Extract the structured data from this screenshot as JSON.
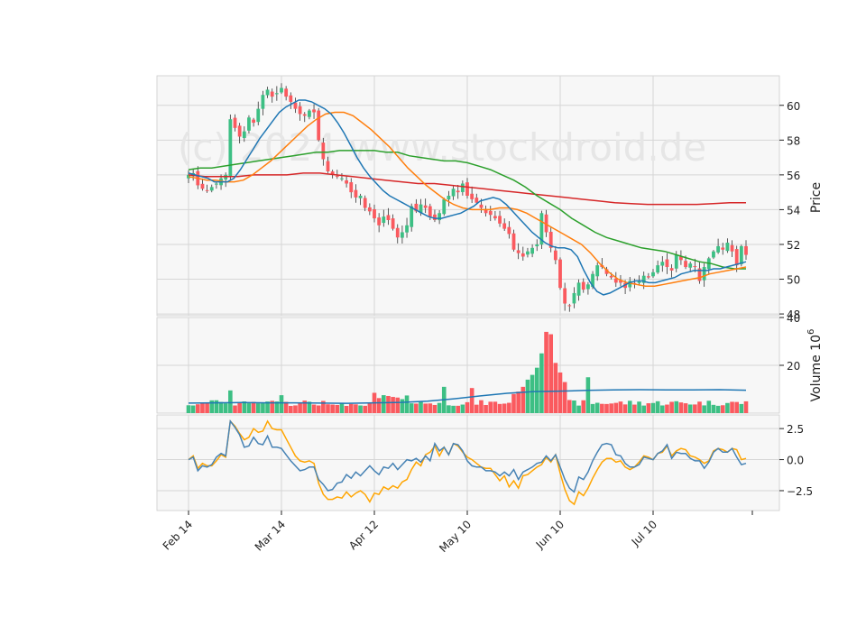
{
  "chart_data": {
    "type": "candlestick",
    "watermark": "(c) 2024 www.stockdroid.de",
    "colors": {
      "up": "#3dbf84",
      "down": "#fa5a5f",
      "sma_fast": "#1f77b4",
      "sma_mid": "#ff7f0e",
      "sma_slow": "#2ca02c",
      "sma_long": "#d62728",
      "vol_avg": "#1f77b4",
      "osc_a": "#4682b4",
      "osc_b": "#ffa500",
      "panel_bg": "#f7f7f7",
      "grid": "#d6d6d6"
    },
    "x_ticks": [
      {
        "label": "Feb 14",
        "index": 0
      },
      {
        "label": "Mar 14",
        "index": 20
      },
      {
        "label": "Apr 12",
        "index": 40
      },
      {
        "label": "May 10",
        "index": 60
      },
      {
        "label": "Jun 10",
        "index": 80
      },
      {
        "label": "Jul 10",
        "index": 100
      }
    ],
    "price_panel": {
      "ylabel": "Price",
      "ylim": [
        47.9,
        61.7
      ],
      "ticks": [
        48,
        50,
        52,
        54,
        56,
        58,
        60
      ],
      "close": [
        56.0,
        56.1,
        55.4,
        55.2,
        55.1,
        55.3,
        55.5,
        55.8,
        56.0,
        59.2,
        58.7,
        58.2,
        58.5,
        59.3,
        59.0,
        59.8,
        60.6,
        60.9,
        60.5,
        60.7,
        61.0,
        60.5,
        60.2,
        59.8,
        59.5,
        59.4,
        59.7,
        59.6,
        58.0,
        56.9,
        56.2,
        56.0,
        55.9,
        55.8,
        55.5,
        55.0,
        54.7,
        54.8,
        54.1,
        53.9,
        53.5,
        53.1,
        53.6,
        53.4,
        52.9,
        52.4,
        52.7,
        53.1,
        54.2,
        53.9,
        54.3,
        54.1,
        53.6,
        53.4,
        53.8,
        54.6,
        54.8,
        55.2,
        55.0,
        55.5,
        54.8,
        54.6,
        54.4,
        54.1,
        53.8,
        53.7,
        53.5,
        53.2,
        52.9,
        52.6,
        51.7,
        51.5,
        51.3,
        51.6,
        51.8,
        52.0,
        53.8,
        52.7,
        51.8,
        51.1,
        49.5,
        48.6,
        48.5,
        49.2,
        49.8,
        49.4,
        49.7,
        50.3,
        50.8,
        50.7,
        50.3,
        50.1,
        49.8,
        49.8,
        49.5,
        49.9,
        49.7,
        49.9,
        50.2,
        50.1,
        50.4,
        50.8,
        51.0,
        50.7,
        50.5,
        51.4,
        51.1,
        50.7,
        50.9,
        50.7,
        49.9,
        50.7,
        51.2,
        51.6,
        51.9,
        51.7,
        52.1,
        51.6,
        50.8,
        51.9,
        51.4
      ],
      "volatility": 0.35,
      "sma_fast": [
        56.1,
        56.0,
        55.9,
        55.8,
        55.6,
        55.6,
        55.6,
        55.8,
        56.3,
        56.9,
        57.5,
        58.1,
        58.6,
        59.1,
        59.6,
        59.9,
        60.1,
        60.3,
        60.3,
        60.2,
        60.0,
        59.8,
        59.5,
        59.0,
        58.4,
        57.7,
        57.0,
        56.4,
        55.9,
        55.5,
        55.1,
        54.8,
        54.6,
        54.4,
        54.2,
        54.0,
        53.8,
        53.6,
        53.5,
        53.5,
        53.6,
        53.7,
        53.8,
        54.0,
        54.2,
        54.5,
        54.6,
        54.7,
        54.6,
        54.3,
        53.9,
        53.5,
        53.1,
        52.7,
        52.4,
        52.1,
        51.9,
        51.8,
        51.8,
        51.7,
        51.3,
        50.5,
        49.8,
        49.3,
        49.1,
        49.2,
        49.4,
        49.6,
        49.8,
        49.9,
        49.9,
        49.8,
        49.8,
        49.9,
        50.0,
        50.1,
        50.3,
        50.4,
        50.5,
        50.5,
        50.5,
        50.6,
        50.6,
        50.7,
        50.8,
        50.9,
        51.0
      ],
      "sma_fast_start": 0,
      "sma_mid": [
        55.9,
        55.8,
        55.7,
        55.7,
        55.6,
        55.6,
        55.7,
        56.0,
        56.4,
        56.8,
        57.3,
        57.8,
        58.3,
        58.8,
        59.2,
        59.5,
        59.6,
        59.6,
        59.4,
        59.0,
        58.6,
        58.1,
        57.6,
        57.0,
        56.4,
        55.9,
        55.4,
        55.0,
        54.6,
        54.3,
        54.1,
        54.0,
        54.0,
        54.0,
        54.1,
        54.1,
        54.0,
        53.8,
        53.5,
        53.2,
        52.9,
        52.6,
        52.3,
        52.0,
        51.5,
        50.9,
        50.4,
        50.0,
        49.8,
        49.7,
        49.6,
        49.6,
        49.7,
        49.8,
        49.9,
        50.0,
        50.1,
        50.3,
        50.4,
        50.5,
        50.6,
        50.7
      ],
      "sma_slow": [
        56.3,
        56.4,
        56.4,
        56.5,
        56.6,
        56.7,
        56.8,
        56.9,
        57.0,
        57.1,
        57.2,
        57.3,
        57.3,
        57.4,
        57.4,
        57.4,
        57.4,
        57.3,
        57.3,
        57.1,
        57.0,
        56.9,
        56.8,
        56.8,
        56.7,
        56.5,
        56.3,
        56.0,
        55.7,
        55.3,
        54.8,
        54.4,
        54.0,
        53.5,
        53.1,
        52.7,
        52.4,
        52.2,
        52.0,
        51.8,
        51.7,
        51.6,
        51.4,
        51.2,
        51.0,
        50.9,
        50.7,
        50.6,
        50.6
      ],
      "sma_long": [
        56.0,
        55.9,
        55.9,
        55.9,
        56.0,
        56.0,
        56.0,
        56.1,
        56.1,
        56.0,
        55.9,
        55.8,
        55.7,
        55.6,
        55.5,
        55.5,
        55.4,
        55.3,
        55.2,
        55.1,
        55.0,
        54.9,
        54.8,
        54.7,
        54.6,
        54.5,
        54.4,
        54.35,
        54.3,
        54.3,
        54.3,
        54.3,
        54.35,
        54.4,
        54.4
      ]
    },
    "volume_panel": {
      "ylabel": "Volume",
      "ylabel_exponent": "6",
      "ylim": [
        0,
        40
      ],
      "ticks": [
        20,
        40
      ],
      "avg_values": [
        4.2,
        4.3,
        4.4,
        4.3,
        4.3,
        4.2,
        4.1,
        4.3,
        4.5,
        5.0,
        6.0,
        7.2,
        8.3,
        9.0,
        9.2,
        9.5,
        9.7,
        9.8,
        9.7,
        9.7,
        9.8,
        9.6
      ]
    },
    "osc_panel": {
      "ylim": [
        -4.1,
        3.6
      ],
      "ticks": [
        2.5,
        0.0,
        -2.5
      ],
      "tick_labels": [
        "2.5",
        "0.0",
        "−2.5"
      ],
      "series_a": [
        0.0,
        0.2,
        -0.9,
        -0.5,
        -0.6,
        -0.4,
        0.2,
        0.5,
        0.3,
        3.1,
        2.6,
        2.0,
        1.0,
        1.1,
        1.8,
        1.3,
        1.2,
        1.9,
        1.0,
        1.0,
        0.9,
        0.4,
        -0.1,
        -0.5,
        -0.9,
        -0.8,
        -0.6,
        -0.6,
        -1.6,
        -2.0,
        -2.5,
        -2.4,
        -1.9,
        -1.8,
        -1.2,
        -1.5,
        -1.0,
        -1.3,
        -0.9,
        -0.5,
        -0.9,
        -1.2,
        -0.6,
        -0.7,
        -0.3,
        -0.8,
        -0.4,
        0.0,
        -0.1,
        0.1,
        -0.2,
        0.3,
        -0.1,
        1.3,
        0.7,
        1.0,
        0.4,
        1.3,
        1.2,
        0.7,
        -0.1,
        -0.5,
        -0.6,
        -0.6,
        -0.9,
        -0.9,
        -1.0,
        -1.3,
        -1.0,
        -1.3,
        -0.8,
        -1.6,
        -1.0,
        -0.8,
        -0.6,
        -0.3,
        -0.2,
        0.3,
        -0.1,
        0.4,
        -0.6,
        -1.6,
        -2.3,
        -2.6,
        -1.4,
        -1.6,
        -1.0,
        -0.1,
        0.6,
        1.2,
        1.3,
        1.2,
        0.4,
        0.3,
        -0.3,
        -0.6,
        -0.6,
        -0.4,
        0.2,
        0.1,
        0.0,
        0.5,
        0.7,
        1.2,
        0.1,
        0.6,
        0.5,
        0.5,
        0.1,
        -0.1,
        -0.1,
        -0.7,
        -0.2,
        0.6,
        0.9,
        0.6,
        0.6,
        0.9,
        0.2,
        -0.4,
        -0.3
      ],
      "series_b": [
        0.0,
        0.3,
        -0.7,
        -0.3,
        -0.5,
        -0.5,
        -0.1,
        0.4,
        0.2,
        3.1,
        2.7,
        2.1,
        1.6,
        1.8,
        2.5,
        2.2,
        2.3,
        3.1,
        2.5,
        2.4,
        2.4,
        1.7,
        1.0,
        0.3,
        -0.1,
        -0.2,
        -0.1,
        -0.3,
        -1.9,
        -2.8,
        -3.2,
        -3.2,
        -3.0,
        -3.1,
        -2.6,
        -3.0,
        -2.7,
        -2.5,
        -2.8,
        -3.4,
        -2.7,
        -2.8,
        -2.2,
        -2.4,
        -2.1,
        -2.3,
        -1.8,
        -1.6,
        -0.8,
        -0.2,
        -0.5,
        0.4,
        0.6,
        1.1,
        0.3,
        1.0,
        0.4,
        1.3,
        1.1,
        0.6,
        0.2,
        0.0,
        -0.3,
        -0.6,
        -0.7,
        -0.7,
        -1.2,
        -1.7,
        -1.3,
        -2.2,
        -1.7,
        -2.3,
        -1.3,
        -1.2,
        -0.9,
        -0.6,
        -0.4,
        0.2,
        -0.2,
        0.4,
        -1.1,
        -2.4,
        -3.3,
        -3.6,
        -2.6,
        -2.9,
        -2.3,
        -1.5,
        -0.8,
        -0.2,
        0.1,
        0.1,
        -0.2,
        -0.1,
        -0.6,
        -0.8,
        -0.6,
        -0.2,
        0.3,
        0.2,
        0.0,
        0.5,
        0.6,
        1.1,
        0.3,
        0.7,
        0.9,
        0.8,
        0.3,
        0.2,
        0.0,
        -0.3,
        -0.1,
        0.7,
        0.9,
        0.8,
        0.6,
        0.9,
        0.8,
        0.0,
        0.1
      ]
    }
  }
}
